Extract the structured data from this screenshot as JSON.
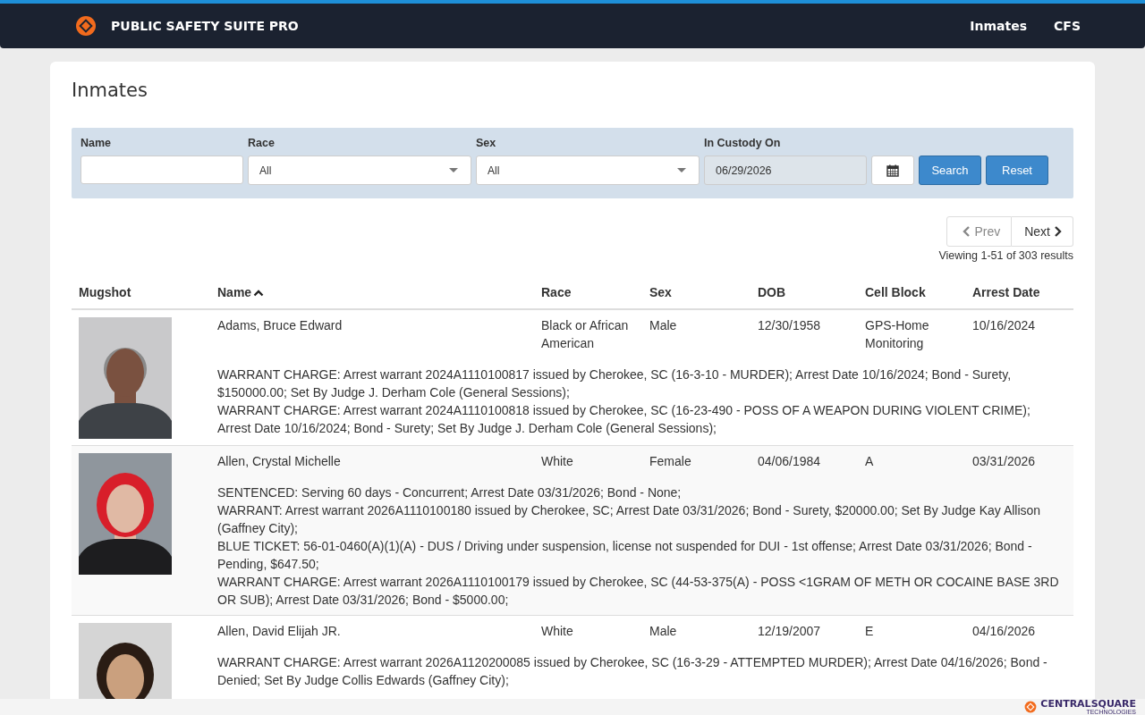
{
  "navbar": {
    "brand": "PUBLIC SAFETY SUITE PRO",
    "links": [
      {
        "label": "Inmates"
      },
      {
        "label": "CFS"
      }
    ]
  },
  "page_title": "Inmates",
  "filters": {
    "name": {
      "label": "Name"
    },
    "race": {
      "label": "Race",
      "value": "All"
    },
    "sex": {
      "label": "Sex",
      "value": "All"
    },
    "custody": {
      "label": "In Custody On",
      "value": "06/29/2026"
    },
    "buttons": [
      "Search",
      "Reset"
    ]
  },
  "pager": {
    "prev": {
      "label": "Prev",
      "disabled": true
    },
    "next": {
      "label": "Next",
      "disabled": false
    },
    "summary": "Viewing 1-51 of 303 results"
  },
  "columns": [
    {
      "label": "Mugshot",
      "sorted": false
    },
    {
      "label": "Name",
      "sorted": true
    },
    {
      "label": "Race",
      "sorted": false
    },
    {
      "label": "Sex",
      "sorted": false
    },
    {
      "label": "DOB",
      "sorted": false
    },
    {
      "label": "Cell Block",
      "sorted": false
    },
    {
      "label": "Arrest Date",
      "sorted": false
    }
  ],
  "rows": [
    {
      "mugshot": {
        "kind": "picture"
      },
      "name": "Adams, Bruce Edward",
      "race": "Black or African American",
      "sex": "Male",
      "dob": "12/30/1958",
      "cell_block": "GPS-Home Monitoring",
      "arrest_date": "10/16/2024",
      "charges": [
        "WARRANT CHARGE: Arrest warrant 2024A1110100817 issued by Cherokee, SC (16-3-10 - MURDER); Arrest Date 10/16/2024; Bond - Surety, $150000.00; Set By Judge J. Derham Cole (General Sessions);",
        "WARRANT CHARGE: Arrest warrant 2024A1110100818 issued by Cherokee, SC (16-23-490 - POSS OF A WEAPON DURING VIOLENT CRIME); Arrest Date 10/16/2024; Bond - Surety; Set By Judge J. Derham Cole (General Sessions);"
      ]
    },
    {
      "mugshot": {
        "kind": "picture"
      },
      "name": "Allen, Crystal Michelle",
      "race": "White",
      "sex": "Female",
      "dob": "04/06/1984",
      "cell_block": "A",
      "arrest_date": "03/31/2026",
      "charges": [
        "SENTENCED: Serving 60 days - Concurrent; Arrest Date 03/31/2026; Bond - None;",
        "WARRANT: Arrest warrant 2026A1110100180 issued by Cherokee, SC; Arrest Date 03/31/2026; Bond - Surety, $20000.00; Set By Judge Kay Allison (Gaffney City);",
        "BLUE TICKET: 56-01-0460(A)(1)(A) - DUS / Driving under suspension, license not suspended for DUI - 1st offense; Arrest Date 03/31/2026; Bond - Pending, $647.50;",
        "WARRANT CHARGE: Arrest warrant 2026A1110100179 issued by Cherokee, SC (44-53-375(A) - POSS <1GRAM OF METH OR COCAINE BASE 3RD OR SUB); Arrest Date 03/31/2026; Bond - $5000.00;"
      ]
    },
    {
      "mugshot": {
        "kind": "picture"
      },
      "name": "Allen, David Elijah JR.",
      "race": "White",
      "sex": "Male",
      "dob": "12/19/2007",
      "cell_block": "E",
      "arrest_date": "04/16/2026",
      "charges": [
        "WARRANT CHARGE: Arrest warrant 2026A1120200085 issued by Cherokee, SC (16-3-29 - ATTEMPTED MURDER); Arrest Date 04/16/2026; Bond - Denied; Set By Judge Collis Edwards (Gaffney City);"
      ]
    }
  ],
  "footer": {
    "logo": "CENTRALSQUARE",
    "tagline": "TECHNOLOGIES"
  }
}
